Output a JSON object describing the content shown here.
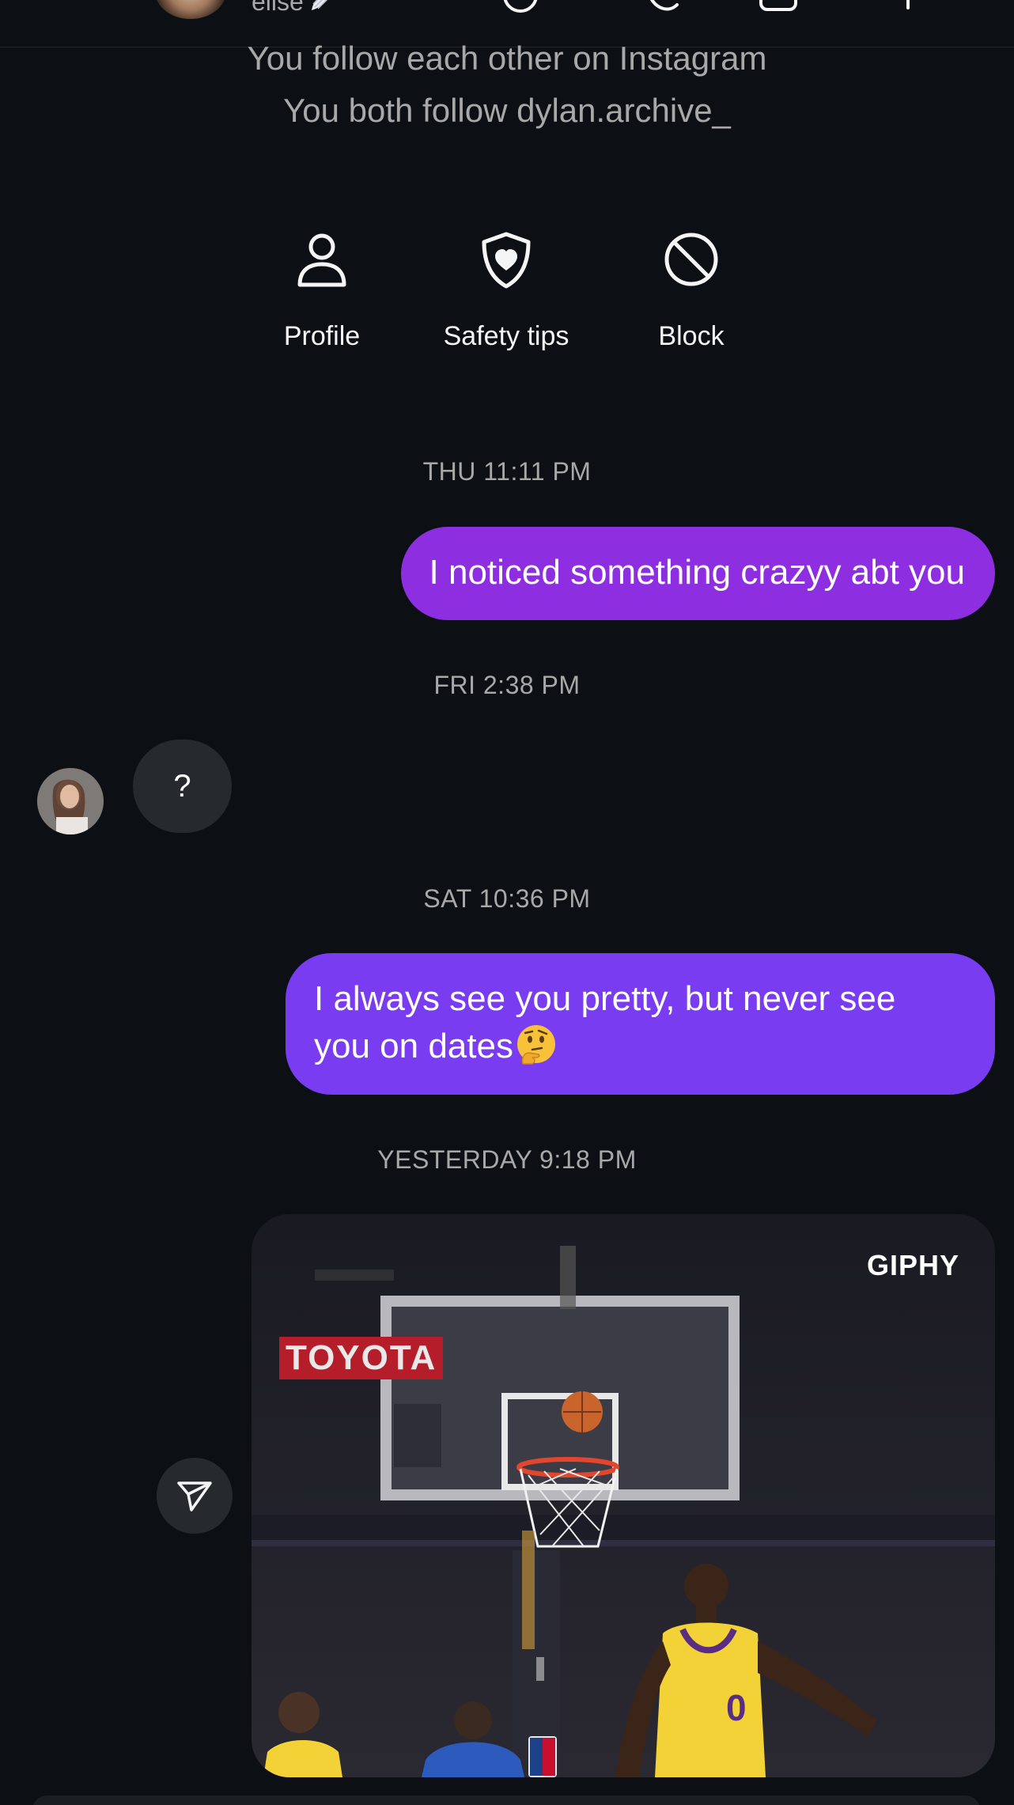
{
  "header": {
    "name": "elise"
  },
  "intro": {
    "line1": "You follow each other on Instagram",
    "line2": "You both follow dylan.archive_"
  },
  "actions": [
    {
      "label": "Profile",
      "icon": "person-icon"
    },
    {
      "label": "Safety tips",
      "icon": "shield-heart-icon"
    },
    {
      "label": "Block",
      "icon": "block-icon"
    }
  ],
  "messages": [
    {
      "timestamp": "THU 11:11 PM",
      "direction": "outgoing",
      "text": "I noticed something crazyy abt you"
    },
    {
      "timestamp": "FRI 2:38 PM",
      "direction": "incoming",
      "text": "?"
    },
    {
      "timestamp": "SAT 10:36 PM",
      "direction": "outgoing",
      "text_line1": "I always see you pretty, but never see",
      "text_line2": "you on dates",
      "emoji": "thinking-face-icon"
    },
    {
      "timestamp": "YESTERDAY 9:18 PM",
      "direction": "outgoing",
      "type": "gif",
      "gif_label": "GIPHY",
      "gif_sign": "TOYOTA"
    }
  ],
  "colors": {
    "background": "#0c1014",
    "bubble_out_1": "#8d2fe0",
    "bubble_out_2": "#7a3cf1",
    "bubble_in": "#262a2f",
    "muted_text": "#a8a8a8"
  }
}
